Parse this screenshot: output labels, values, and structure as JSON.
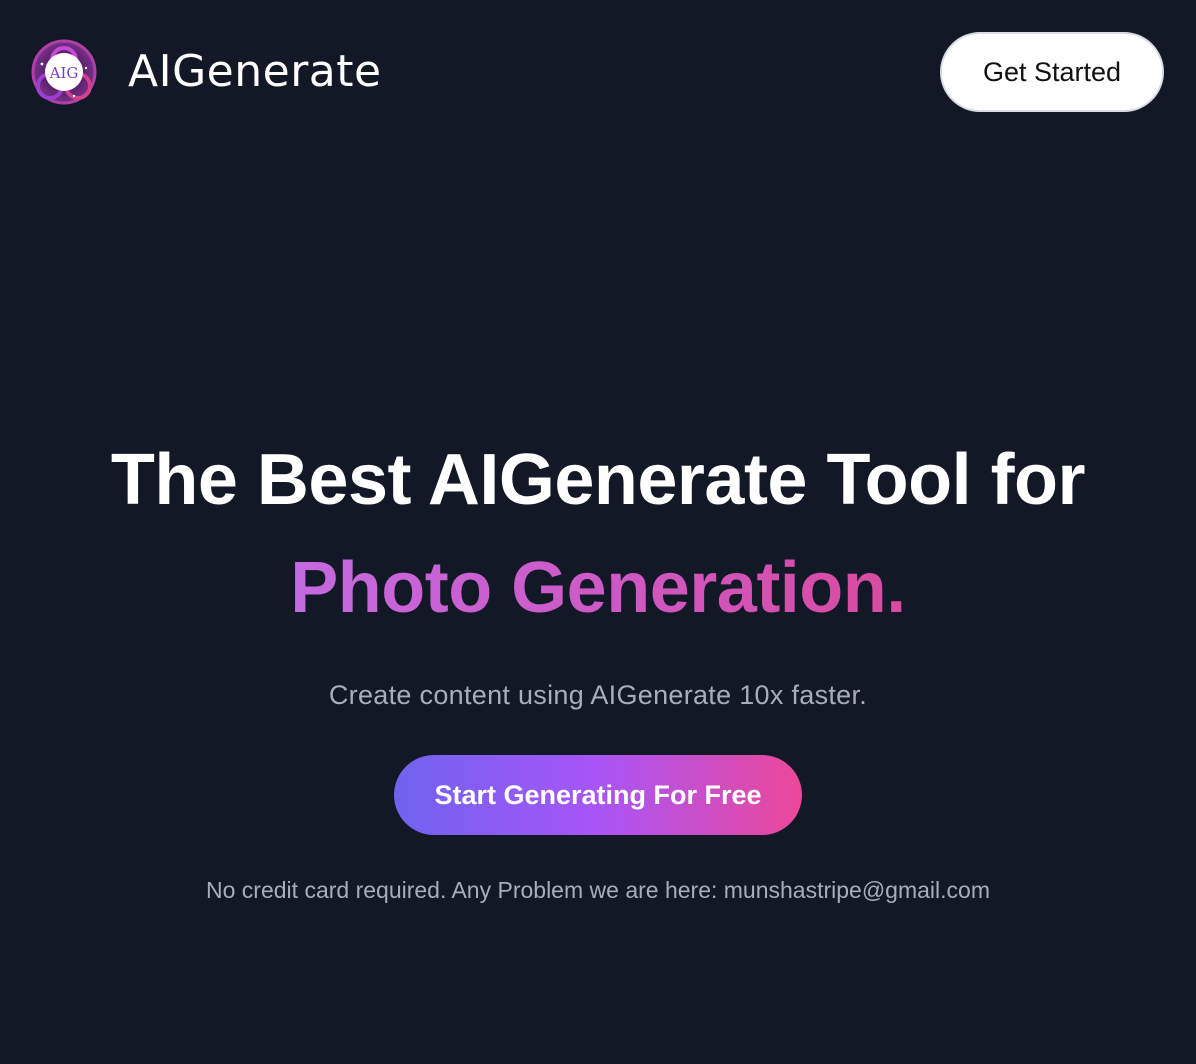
{
  "header": {
    "brand_name": "AIGenerate",
    "logo_text": "AIG",
    "get_started_label": "Get Started"
  },
  "hero": {
    "headline_line1": "The Best AIGenerate Tool for",
    "headline_line2": "Photo Generation.",
    "subtitle": "Create content using AIGenerate 10x faster.",
    "cta_label": "Start Generating For Free",
    "note": "No credit card required. Any Problem we are here: munshastripe@gmail.com"
  },
  "colors": {
    "background": "#121826",
    "accent_gradient_start": "#6f63f0",
    "accent_gradient_mid": "#a855f7",
    "accent_gradient_end": "#ec4899",
    "muted_text": "#a6adbb"
  }
}
